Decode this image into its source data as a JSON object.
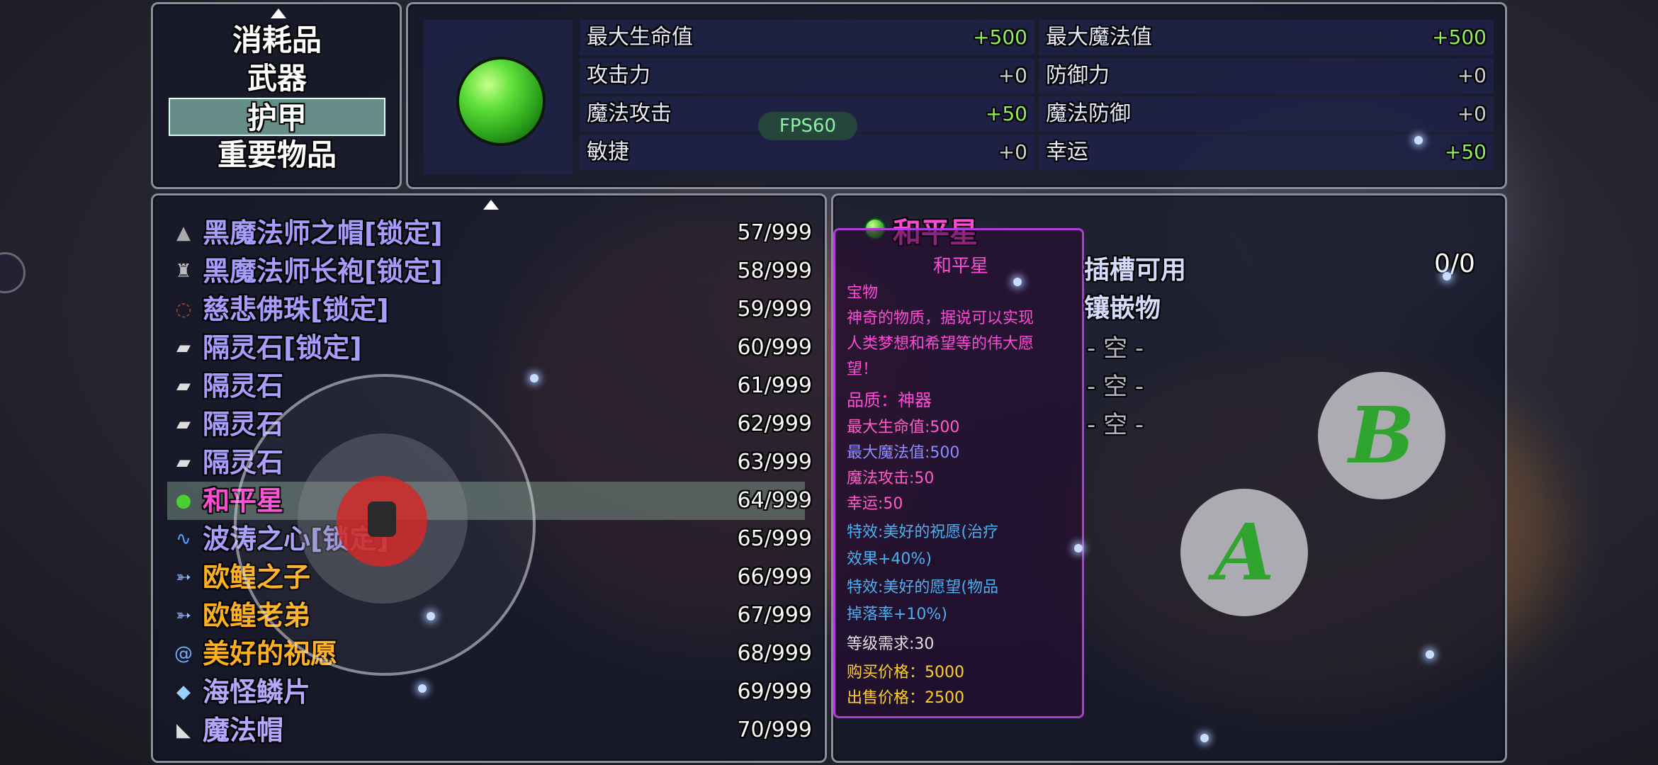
{
  "categories": {
    "items": [
      "消耗品",
      "武器",
      "护甲",
      "重要物品"
    ],
    "selected_index": 2
  },
  "stats": {
    "left": [
      {
        "name": "最大生命值",
        "value": "+500"
      },
      {
        "name": "攻击力",
        "value": "+0"
      },
      {
        "name": "魔法攻击",
        "value": "+50"
      },
      {
        "name": "敏捷",
        "value": "+0"
      }
    ],
    "right": [
      {
        "name": "最大魔法值",
        "value": "+500"
      },
      {
        "name": "防御力",
        "value": "+0"
      },
      {
        "name": "魔法防御",
        "value": "+0"
      },
      {
        "name": "幸运",
        "value": "+50"
      }
    ],
    "fps": "FPS60"
  },
  "items": [
    {
      "name": "黑魔法师之帽[锁定]",
      "count": "57/999",
      "color": "#a99cff",
      "icon": "hat-icon"
    },
    {
      "name": "黑魔法师长袍[锁定]",
      "count": "58/999",
      "color": "#a99cff",
      "icon": "robe-icon"
    },
    {
      "name": "慈悲佛珠[锁定]",
      "count": "59/999",
      "color": "#a99cff",
      "icon": "beads-icon"
    },
    {
      "name": "隔灵石[锁定]",
      "count": "60/999",
      "color": "#a99cff",
      "icon": "stone-icon"
    },
    {
      "name": "隔灵石",
      "count": "61/999",
      "color": "#a99cff",
      "icon": "stone-icon"
    },
    {
      "name": "隔灵石",
      "count": "62/999",
      "color": "#a99cff",
      "icon": "stone-icon"
    },
    {
      "name": "隔灵石",
      "count": "63/999",
      "color": "#a99cff",
      "icon": "stone-icon"
    },
    {
      "name": "和平星",
      "count": "64/999",
      "color": "#ff4ad8",
      "icon": "green-orb-icon"
    },
    {
      "name": "波涛之心[锁定]",
      "count": "65/999",
      "color": "#a99cff",
      "icon": "wave-icon"
    },
    {
      "name": "欧鳇之子",
      "count": "66/999",
      "color": "#ffb020",
      "icon": "fish-icon"
    },
    {
      "name": "欧鳇老弟",
      "count": "67/999",
      "color": "#ffb020",
      "icon": "fish-icon"
    },
    {
      "name": "美好的祝愿",
      "count": "68/999",
      "color": "#ffb020",
      "icon": "swirl-icon"
    },
    {
      "name": "海怪鳞片",
      "count": "69/999",
      "color": "#b5a8ff",
      "icon": "scale-icon"
    },
    {
      "name": "魔法帽",
      "count": "70/999",
      "color": "#b5a8ff",
      "icon": "magic-hat-icon"
    }
  ],
  "selected_item_index": 7,
  "detail": {
    "title": "和平星",
    "tooltip": {
      "name": "和平星",
      "type": "宝物",
      "desc": [
        "神奇的物质，据说可以实现",
        "人类梦想和希望等的伟大愿",
        "望！"
      ],
      "quality": "品质：神器",
      "hp": "最大生命值:500",
      "mp": "最大魔法值:500",
      "matk": "魔法攻击:50",
      "luck": "幸运:50",
      "effect1": [
        "特效:美好的祝愿(治疗",
        "效果+40%)"
      ],
      "effect2": [
        "特效:美好的愿望(物品",
        "掉落率+10%)"
      ],
      "level_req": "等级需求:30",
      "buy_price": "购买价格：5000",
      "sell_price": "出售价格：2500"
    },
    "slots_label": "插槽可用",
    "slots_value": "0/0",
    "inlay_label": "镶嵌物",
    "inlay_slots": [
      "- 空 -",
      "- 空 -",
      "- 空 -"
    ]
  },
  "buttons": {
    "a": "A",
    "b": "B"
  },
  "colors": {
    "panel_border": "#8a8f9e",
    "plus_value": "#8cf05a",
    "rare_pink": "#ff4ad8",
    "tooltip_border": "#b03bd8",
    "button_green": "#2fa52f"
  }
}
